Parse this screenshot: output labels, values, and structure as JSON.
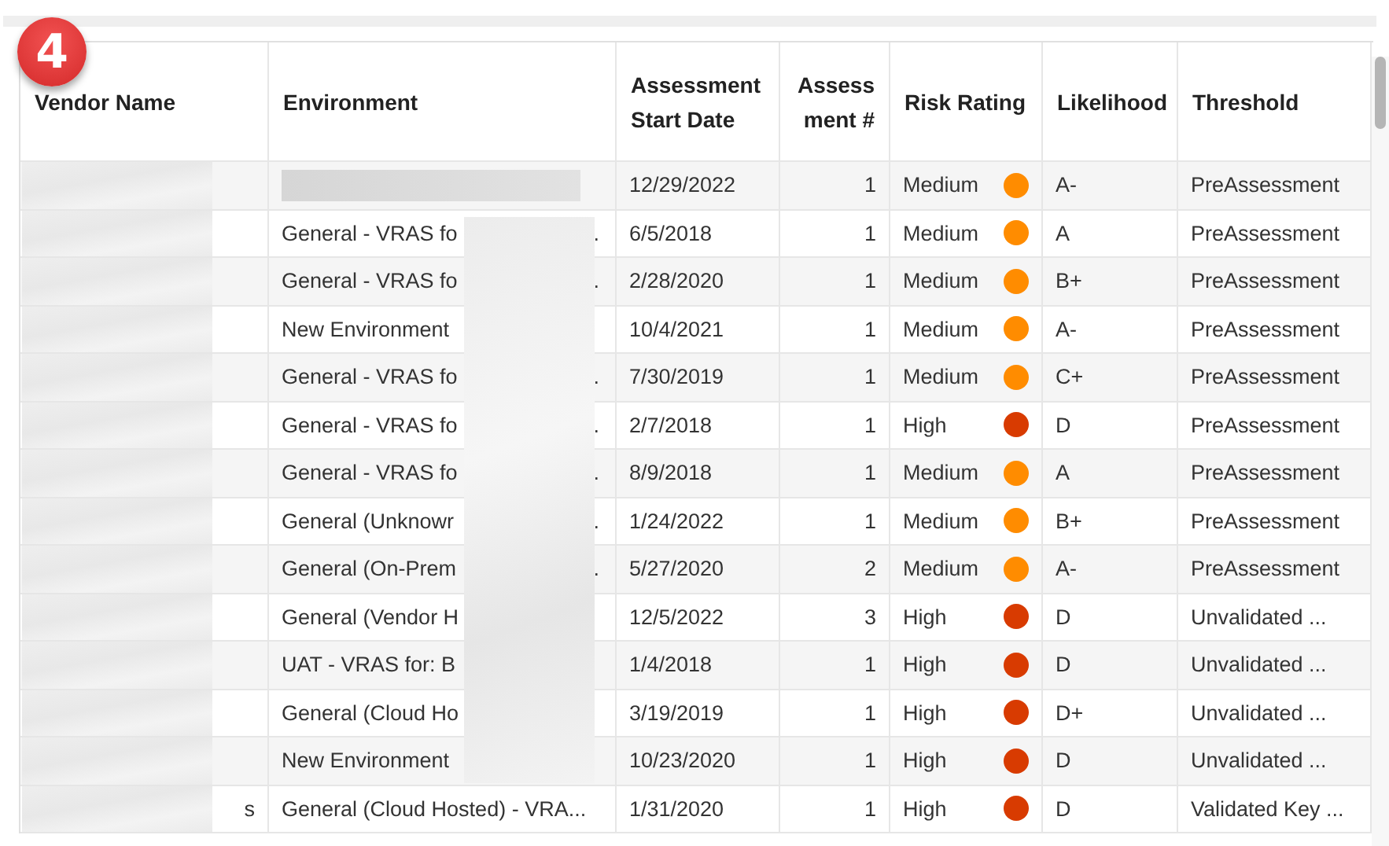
{
  "step_badge": "4",
  "table": {
    "columns": [
      "Vendor Name",
      "Environment",
      "Assessment Start Date",
      "Assess ment #",
      "Risk Rating",
      "Likelihood",
      "Threshold"
    ],
    "rows": [
      {
        "vendor": "",
        "environment": "",
        "env_tail": "",
        "start_date": "12/29/2022",
        "assessment_no": "1",
        "risk": "Medium",
        "color": "#ff8c00",
        "likelihood": "A-",
        "threshold": "PreAssessment"
      },
      {
        "vendor": "",
        "environment": "General - VRAS fo",
        "env_tail": ".",
        "start_date": "6/5/2018",
        "assessment_no": "1",
        "risk": "Medium",
        "color": "#ff8c00",
        "likelihood": "A",
        "threshold": "PreAssessment"
      },
      {
        "vendor": "",
        "environment": "General - VRAS fo",
        "env_tail": ".",
        "start_date": "2/28/2020",
        "assessment_no": "1",
        "risk": "Medium",
        "color": "#ff8c00",
        "likelihood": "B+",
        "threshold": "PreAssessment"
      },
      {
        "vendor": "",
        "environment": "New Environment",
        "env_tail": "",
        "start_date": "10/4/2021",
        "assessment_no": "1",
        "risk": "Medium",
        "color": "#ff8c00",
        "likelihood": "A-",
        "threshold": "PreAssessment"
      },
      {
        "vendor": "",
        "environment": "General - VRAS fo",
        "env_tail": ".",
        "start_date": "7/30/2019",
        "assessment_no": "1",
        "risk": "Medium",
        "color": "#ff8c00",
        "likelihood": "C+",
        "threshold": "PreAssessment"
      },
      {
        "vendor": "",
        "environment": "General - VRAS fo",
        "env_tail": ".",
        "start_date": "2/7/2018",
        "assessment_no": "1",
        "risk": "High",
        "color": "#d83b01",
        "likelihood": "D",
        "threshold": "PreAssessment"
      },
      {
        "vendor": "",
        "environment": "General - VRAS fo",
        "env_tail": ".",
        "start_date": "8/9/2018",
        "assessment_no": "1",
        "risk": "Medium",
        "color": "#ff8c00",
        "likelihood": "A",
        "threshold": "PreAssessment"
      },
      {
        "vendor": "",
        "environment": "General (Unknowr",
        "env_tail": ".",
        "start_date": "1/24/2022",
        "assessment_no": "1",
        "risk": "Medium",
        "color": "#ff8c00",
        "likelihood": "B+",
        "threshold": "PreAssessment"
      },
      {
        "vendor": "",
        "environment": "General (On-Prem",
        "env_tail": ".",
        "start_date": "5/27/2020",
        "assessment_no": "2",
        "risk": "Medium",
        "color": "#ff8c00",
        "likelihood": "A-",
        "threshold": "PreAssessment"
      },
      {
        "vendor": "",
        "environment": "General (Vendor H",
        "env_tail": "",
        "start_date": "12/5/2022",
        "assessment_no": "3",
        "risk": "High",
        "color": "#d83b01",
        "likelihood": "D",
        "threshold": "Unvalidated ..."
      },
      {
        "vendor": "",
        "environment": "UAT - VRAS for: B",
        "env_tail": "",
        "start_date": "1/4/2018",
        "assessment_no": "1",
        "risk": "High",
        "color": "#d83b01",
        "likelihood": "D",
        "threshold": "Unvalidated ..."
      },
      {
        "vendor": "",
        "environment": "General (Cloud Ho",
        "env_tail": "",
        "start_date": "3/19/2019",
        "assessment_no": "1",
        "risk": "High",
        "color": "#d83b01",
        "likelihood": "D+",
        "threshold": "Unvalidated ..."
      },
      {
        "vendor": "",
        "environment": "New Environment",
        "env_tail": "",
        "start_date": "10/23/2020",
        "assessment_no": "1",
        "risk": "High",
        "color": "#d83b01",
        "likelihood": "D",
        "threshold": "Unvalidated ..."
      },
      {
        "vendor": "s",
        "environment": "General (Cloud Hosted) - VRA...",
        "env_tail": "",
        "start_date": "1/31/2020",
        "assessment_no": "1",
        "risk": "High",
        "color": "#d83b01",
        "likelihood": "D",
        "threshold": "Validated Key ..."
      }
    ]
  }
}
